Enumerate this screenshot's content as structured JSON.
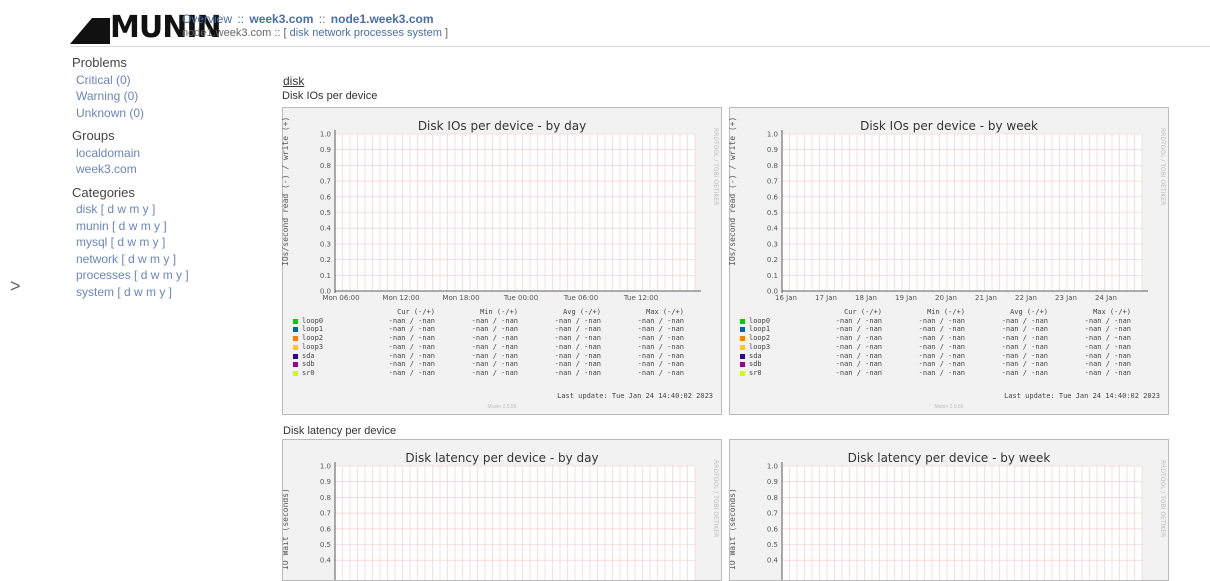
{
  "logo": {
    "text": "MUNIN"
  },
  "breadcrumb": {
    "overview": "Overview",
    "sep1": "::",
    "domain": "week3.com",
    "sep2": "::",
    "node": "node1.week3.com"
  },
  "subnav": {
    "prefix": "node1.week3.com :: [",
    "links": [
      "disk",
      "network",
      "processes",
      "system"
    ],
    "suffix": "]"
  },
  "sidebar": {
    "problems_title": "Problems",
    "problems": [
      "Critical (0)",
      "Warning (0)",
      "Unknown (0)"
    ],
    "groups_title": "Groups",
    "groups": [
      "localdomain",
      "week3.com"
    ],
    "categories_title": "Categories",
    "categories": [
      "disk [ d w m y ]",
      "munin [ d w m y ]",
      "mysql [ d w m y ]",
      "network [ d w m y ]",
      "processes [ d w m y ]",
      "system [ d w m y ]"
    ]
  },
  "expand_icon": ">",
  "main": {
    "category": "disk",
    "graph1_heading": "Disk IOs per device",
    "graph2_heading": "Disk latency per device"
  },
  "graph1": {
    "day": {
      "title": "Disk IOs per device - by day",
      "vlabel": "IOs/second read (-) / write (+)",
      "rlabel": "RRDTOOL / TOBI OETIKER",
      "xticks": [
        "Mon 06:00",
        "Mon 12:00",
        "Mon 18:00",
        "Tue 00:00",
        "Tue 06:00",
        "Tue 12:00"
      ]
    },
    "week": {
      "title": "Disk IOs per device - by week",
      "vlabel": "IOs/second read (-) / write (+)",
      "rlabel": "RRDTOOL / TOBI OETIKER",
      "xticks": [
        "16 Jan",
        "17 Jan",
        "18 Jan",
        "19 Jan",
        "20 Jan",
        "21 Jan",
        "22 Jan",
        "23 Jan",
        "24 Jan"
      ]
    },
    "yticks": [
      "1.0",
      "0.9",
      "0.8",
      "0.7",
      "0.6",
      "0.5",
      "0.4",
      "0.3",
      "0.2",
      "0.1",
      "0.0"
    ],
    "legend_headers": [
      "Cur (-/+)",
      "Min (-/+)",
      "Avg (-/+)",
      "Max (-/+)"
    ],
    "legend_rows": [
      {
        "name": "loop0",
        "color": "#00cc00",
        "vals": [
          "-nan / -nan",
          "-nan / -nan",
          "-nan / -nan",
          "-nan / -nan"
        ]
      },
      {
        "name": "loop1",
        "color": "#0066b3",
        "vals": [
          "-nan / -nan",
          "-nan / -nan",
          "-nan / -nan",
          "-nan / -nan"
        ]
      },
      {
        "name": "loop2",
        "color": "#ff8000",
        "vals": [
          "-nan / -nan",
          "-nan / -nan",
          "-nan / -nan",
          "-nan / -nan"
        ]
      },
      {
        "name": "loop3",
        "color": "#ffcc00",
        "vals": [
          "-nan / -nan",
          "-nan / -nan",
          "-nan / -nan",
          "-nan / -nan"
        ]
      },
      {
        "name": "sda",
        "color": "#330099",
        "vals": [
          "-nan / -nan",
          "-nan / -nan",
          "-nan / -nan",
          "-nan / -nan"
        ]
      },
      {
        "name": "sdb",
        "color": "#990099",
        "vals": [
          "-nan / -nan",
          "-nan / -nan",
          "-nan / -nan",
          "-nan / -nan"
        ]
      },
      {
        "name": "sr0",
        "color": "#ccff00",
        "vals": [
          "-nan / -nan",
          "-nan / -nan",
          "-nan / -nan",
          "-nan / -nan"
        ]
      }
    ],
    "last_update": "Last update: Tue Jan 24 14:40:02 2023",
    "munin_version": "Munin 2.0.56"
  },
  "graph2": {
    "day": {
      "title": "Disk latency per device - by day",
      "vlabel": "IO Wait (seconds)",
      "rlabel": "RRDTOOL / TOBI OETIKER"
    },
    "week": {
      "title": "Disk latency per device - by week",
      "vlabel": "IO Wait (seconds)",
      "rlabel": "RRDTOOL / TOBI OETIKER"
    },
    "yticks": [
      "1.0",
      "0.9",
      "0.8",
      "0.7",
      "0.6",
      "0.5",
      "0.4"
    ]
  }
}
